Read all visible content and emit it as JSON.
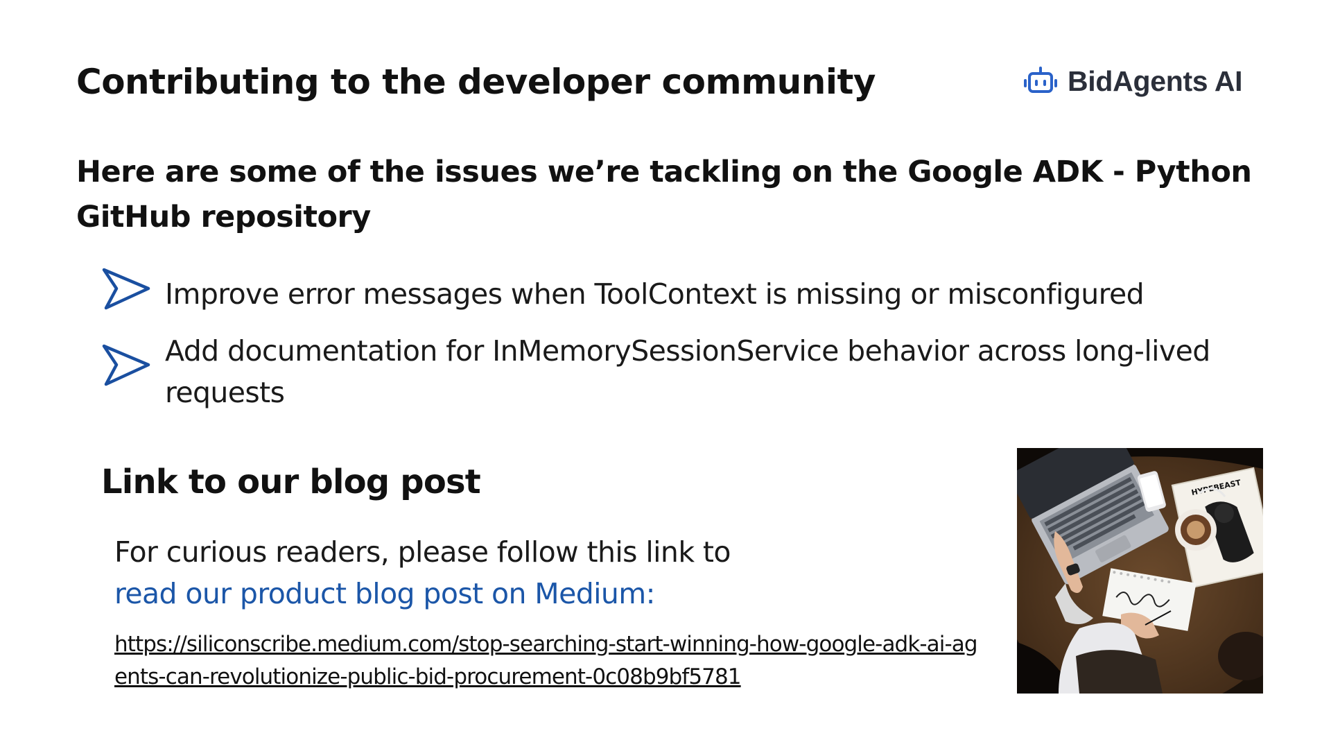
{
  "header": {
    "title": "Contributing to the developer community",
    "logo_text": "BidAgents AI",
    "logo_icon": "robot-icon",
    "logo_color": "#2a62c9"
  },
  "subtitle": "Here are some of the issues we’re tackling on the Google ADK - Python GitHub repository",
  "bullets": [
    {
      "icon": "arrow-chevron-icon",
      "text": "Improve error messages when ToolContext is missing or misconfigured"
    },
    {
      "icon": "arrow-chevron-icon",
      "text": "Add documentation for InMemorySessionService behavior across long-lived requests"
    }
  ],
  "blog": {
    "heading": "Link to our blog post",
    "intro": "For curious readers, please follow this link to",
    "link_text": "read our product blog post on Medium:",
    "url": "https://siliconscribe.medium.com/stop-searching-start-winning-how-google-adk-ai-agents-can-revolutionize-public-bid-procurement-0c08b9bf5781",
    "photo_sign": "HYPEBEAST"
  },
  "colors": {
    "accent_blue": "#1b56a8",
    "arrow_blue": "#1a4fa0",
    "text": "#111111"
  }
}
